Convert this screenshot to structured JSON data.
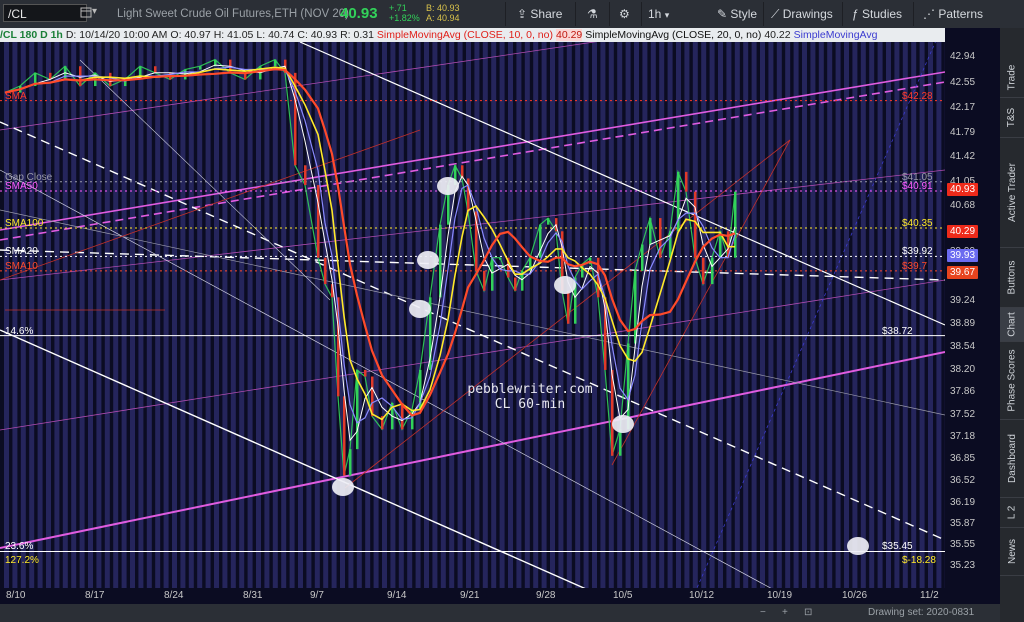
{
  "toolbar": {
    "symbol": "/CL",
    "description": "Light Sweet Crude Oil Futures,ETH (NOV 20)",
    "last": "40.93",
    "change_abs": "+.71",
    "change_pct": "+1.82%",
    "bid": "B: 40.93",
    "ask": "A: 40.94",
    "share_label": "Share",
    "timeframe_label": "1h",
    "style_label": "Style",
    "drawings_label": "Drawings",
    "studies_label": "Studies",
    "patterns_label": "Patterns"
  },
  "infobar": {
    "symbol_tf": "/CL 180 D 1h",
    "date": "D: 10/14/20 10:00 AM",
    "open": "O: 40.97",
    "high": "H: 41.05",
    "low": "L: 40.74",
    "close": "C: 40.93",
    "range": "R: 0.31",
    "sma10_name": "SimpleMovingAvg (CLOSE, 10, 0, no)",
    "sma10_val": "40.29",
    "sma20_name": "SimpleMovingAvg (CLOSE, 20, 0, no)",
    "sma20_val": "40.22",
    "sma_trunc": "SimpleMovingAvg"
  },
  "side_tabs": [
    "Trade",
    "T&S",
    "Active Trader",
    "Buttons",
    "Chart",
    "Phase Scores",
    "Dashboard",
    "L 2",
    "News"
  ],
  "footer": {
    "drawing_set": "Drawing set: 2020-0831"
  },
  "colors": {
    "sma10": "#ff4a2a",
    "sma20": "#ffffff",
    "sma50": "#ff5cff",
    "sma100": "#ffe92a",
    "channel": "#e05ce0",
    "up": "#32d25a",
    "down": "#e03a2a"
  },
  "chart_data": {
    "type": "candlestick",
    "title": "",
    "x_ticks": [
      "8/10",
      "8/17",
      "8/24",
      "8/31",
      "9/7",
      "9/14",
      "9/21",
      "9/28",
      "10/5",
      "10/12",
      "10/19",
      "10/26",
      "11/2"
    ],
    "y_ticks": [
      42.94,
      42.55,
      42.17,
      41.79,
      41.42,
      41.05,
      40.68,
      40.31,
      39.99,
      39.62,
      39.24,
      38.89,
      38.54,
      38.2,
      37.86,
      37.52,
      37.18,
      36.85,
      36.52,
      36.19,
      35.87,
      35.55,
      35.23
    ],
    "ylim": [
      35.0,
      43.2
    ],
    "price_labels": [
      {
        "text": "40.93",
        "value": 40.93,
        "color": "#ee2a1a"
      },
      {
        "text": "40.29",
        "value": 40.29,
        "color": "#ee2a1a"
      },
      {
        "text": "39.93",
        "value": 39.93,
        "color": "#6b6bf0"
      },
      {
        "text": "39.67",
        "value": 39.67,
        "color": "#e8441e"
      }
    ],
    "levels": [
      {
        "name": "",
        "value": 42.28,
        "label": "$42.28",
        "color": "#ff3a2a",
        "style": "dotted",
        "left": "SMA"
      },
      {
        "name": "Gap Close",
        "value": 41.05,
        "label": "$41.05",
        "color": "#9a9aaa",
        "style": "dotted",
        "left": "Gap Close"
      },
      {
        "name": "SMA50",
        "value": 40.91,
        "label": "$40.91",
        "color": "#ff5cff",
        "style": "dotted",
        "left": "SMA50"
      },
      {
        "name": "SMA100",
        "value": 40.35,
        "label": "$40.35",
        "color": "#ffe92a",
        "style": "dotted",
        "left": "SMA100"
      },
      {
        "name": "SMA20",
        "value": 39.92,
        "label": "$39.92",
        "color": "#ffffff",
        "style": "dotted",
        "left": "SMA20"
      },
      {
        "name": "SMA10",
        "value": 39.7,
        "label": "$39.7",
        "color": "#ff4a2a",
        "style": "dotted",
        "left": "SMA10"
      },
      {
        "name": "14.6%",
        "value": 38.72,
        "label": "$38.72",
        "color": "#ffffff",
        "style": "solid",
        "left": "14.6%"
      },
      {
        "name": "23.6%",
        "value": 35.45,
        "label": "$35.45",
        "color": "#ffffff",
        "style": "solid",
        "left": "23.6%"
      },
      {
        "name": "127.2%",
        "value": 35.25,
        "label": "$-18.28",
        "color": "#ffe92a",
        "style": "none",
        "left": "127.2%"
      }
    ],
    "annotation": [
      "pebblewriter.com",
      "CL 60-min"
    ]
  }
}
